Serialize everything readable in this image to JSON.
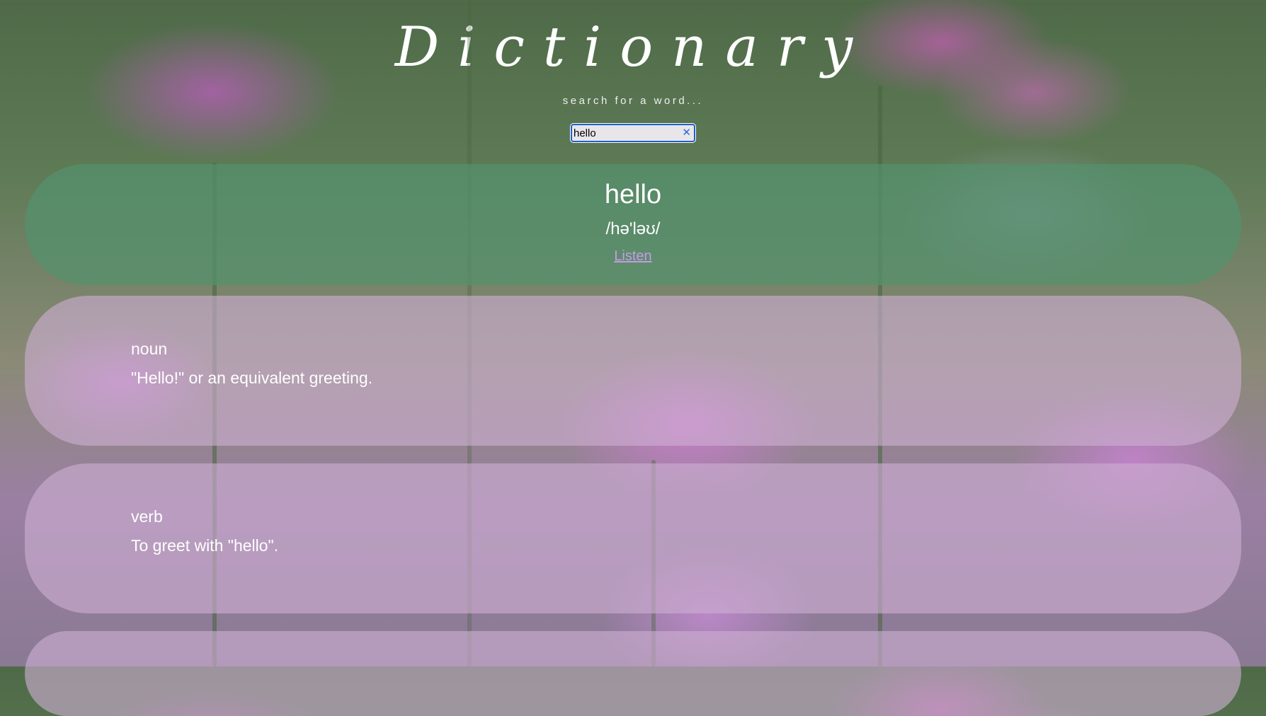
{
  "app": {
    "title": "Dictionary",
    "subtitle": "search for a word..."
  },
  "search": {
    "value": "hello"
  },
  "result": {
    "word": "hello",
    "phonetic": "/hə'ləʊ/",
    "listen_label": "Listen",
    "meanings": [
      {
        "part_of_speech": "noun",
        "definition": "\"Hello!\" or an equivalent greeting."
      },
      {
        "part_of_speech": "verb",
        "definition": "To greet with \"hello\"."
      }
    ]
  },
  "colors": {
    "header_panel": "#5a9473",
    "meaning_panel": "#cfb2d6",
    "link": "#c79ae8",
    "search_border": "#1f5fcc"
  },
  "icons": {
    "clear": "clear-icon"
  }
}
